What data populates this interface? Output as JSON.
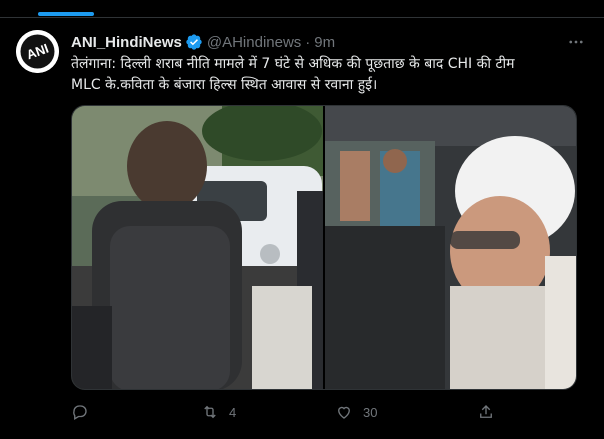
{
  "tweet": {
    "author_name": "ANI_HindiNews",
    "handle": "@AHindinews",
    "separator": "·",
    "time": "9m",
    "text_line1": "तेलंगाना: दिल्ली शराब नीति मामले में 7 घंटे से अधिक की पूछताछ के बाद CHI की टीम",
    "text_line2": "MLC के.कविता के बंजारा हिल्स स्थित आवास से रवाना हुई।",
    "avatar_text": "ANI"
  },
  "actions": {
    "reply_count": "",
    "retweet_count": "4",
    "like_count": "30"
  },
  "colors": {
    "accent": "#1d9bf0",
    "text_primary": "#e7e9ea",
    "text_secondary": "#71767b",
    "background": "#000000"
  },
  "icons": {
    "verified": "verified-badge-icon",
    "more": "more-dots-icon",
    "reply": "reply-bubble-icon",
    "retweet": "retweet-icon",
    "like": "heart-icon",
    "share": "share-icon"
  }
}
